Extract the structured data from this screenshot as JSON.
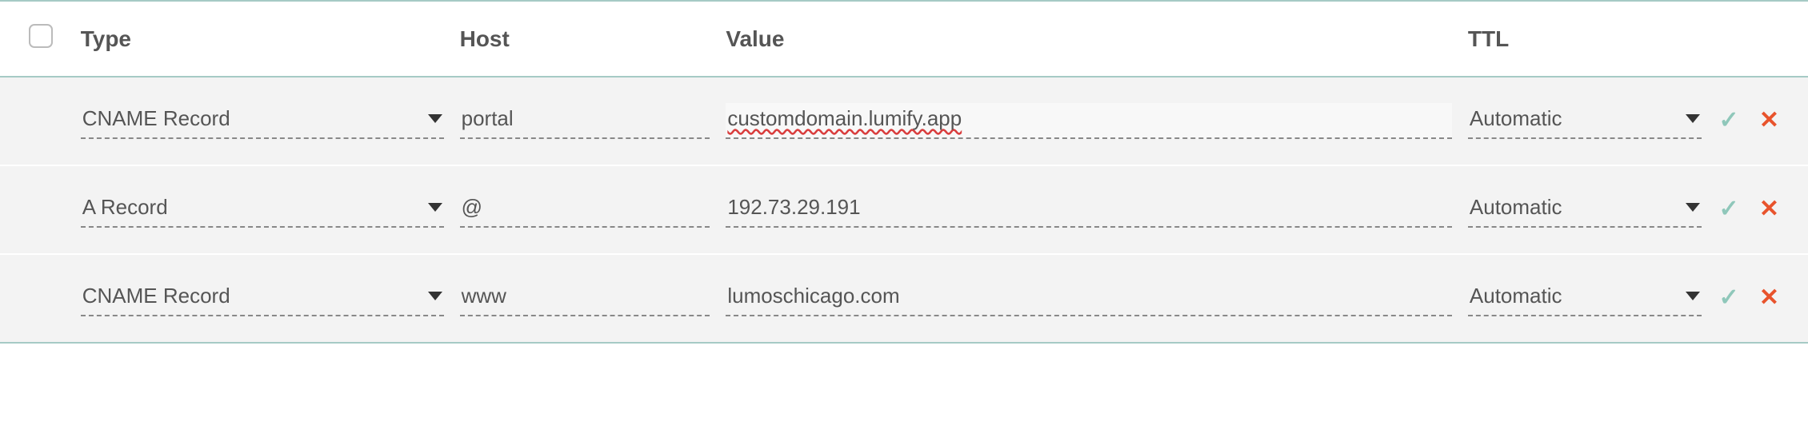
{
  "columns": {
    "type": "Type",
    "host": "Host",
    "value": "Value",
    "ttl": "TTL"
  },
  "rows": [
    {
      "type": "CNAME Record",
      "host": "portal",
      "value": "customdomain.lumify.app",
      "value_spellcheck": true,
      "ttl": "Automatic"
    },
    {
      "type": "A Record",
      "host": "@",
      "value": "192.73.29.191",
      "value_spellcheck": false,
      "ttl": "Automatic"
    },
    {
      "type": "CNAME Record",
      "host": "www",
      "value": "lumoschicago.com",
      "value_spellcheck": false,
      "ttl": "Automatic"
    }
  ]
}
